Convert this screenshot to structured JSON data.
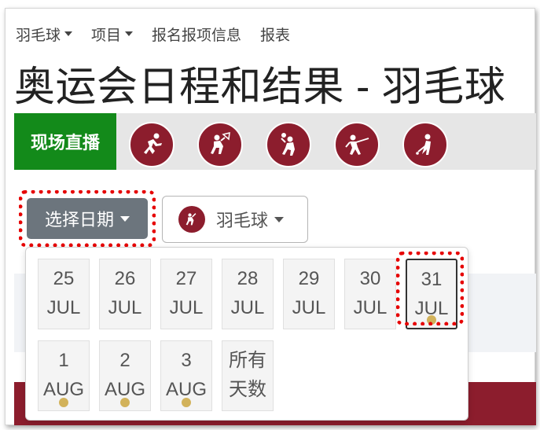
{
  "nav": {
    "items": [
      {
        "label": "羽毛球",
        "has_caret": true
      },
      {
        "label": "项目",
        "has_caret": true
      },
      {
        "label": "报名报项信息",
        "has_caret": false
      },
      {
        "label": "报表",
        "has_caret": false
      }
    ]
  },
  "page": {
    "title": "奥运会日程和结果 - 羽毛球"
  },
  "sport_strip": {
    "live_label": "现场直播",
    "icons": [
      "athletics-icon",
      "badminton-icon",
      "basketball-icon",
      "fencing-icon",
      "golf-icon"
    ]
  },
  "controls": {
    "date_button_label": "选择日期",
    "sport_button_label": "羽毛球"
  },
  "dates": {
    "row1": [
      {
        "day": "25",
        "month": "JUL",
        "has_event": false
      },
      {
        "day": "26",
        "month": "JUL",
        "has_event": false
      },
      {
        "day": "27",
        "month": "JUL",
        "has_event": false
      },
      {
        "day": "28",
        "month": "JUL",
        "has_event": false
      },
      {
        "day": "29",
        "month": "JUL",
        "has_event": false
      },
      {
        "day": "30",
        "month": "JUL",
        "has_event": false
      },
      {
        "day": "31",
        "month": "JUL",
        "has_event": true,
        "selected": true
      }
    ],
    "row2": [
      {
        "day": "1",
        "month": "AUG",
        "has_event": true
      },
      {
        "day": "2",
        "month": "AUG",
        "has_event": true
      },
      {
        "day": "3",
        "month": "AUG",
        "has_event": true
      }
    ],
    "all_days_label_line1": "所有",
    "all_days_label_line2": "天数"
  },
  "colors": {
    "accent_red": "#8c1d2d",
    "live_green": "#138a1a",
    "button_gray": "#6c757d",
    "event_dot": "#d2b25a",
    "highlight": "#e60000"
  }
}
